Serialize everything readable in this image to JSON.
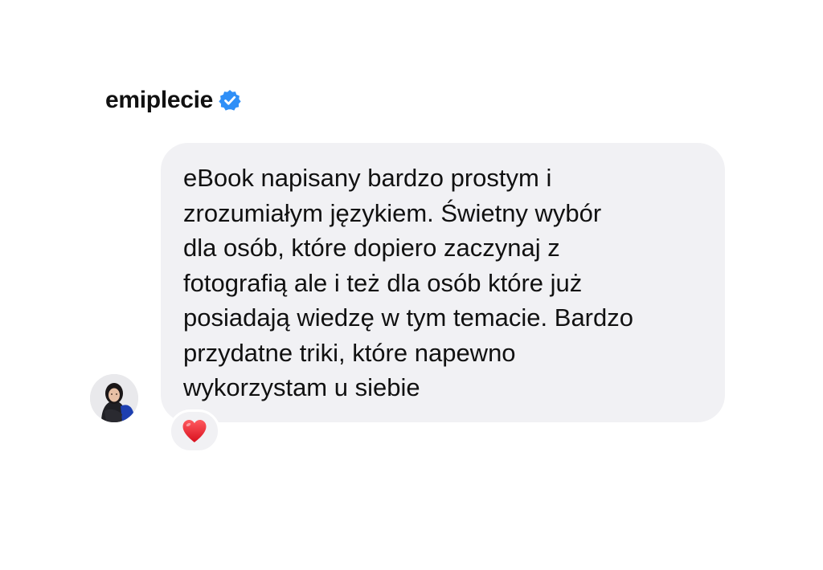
{
  "header": {
    "username": "emiplecie",
    "verified_icon": "verified-badge-icon",
    "verified_color": "#2f8ff7"
  },
  "message": {
    "text": "eBook napisany bardzo prostym i\nzrozumiałym językiem. Świetny wybór\ndla osób, które dopiero zaczynaj z\nfotografią ale i też dla osób które już\nposiadają wiedzę w tym temacie. Bardzo\nprzydatne triki, które napewno\nwykorzystam u siebie",
    "bubble_color": "#f1f1f4"
  },
  "reaction": {
    "icon": "red-heart-icon",
    "color": "#e8202e"
  },
  "avatar": {
    "icon": "profile-avatar"
  }
}
